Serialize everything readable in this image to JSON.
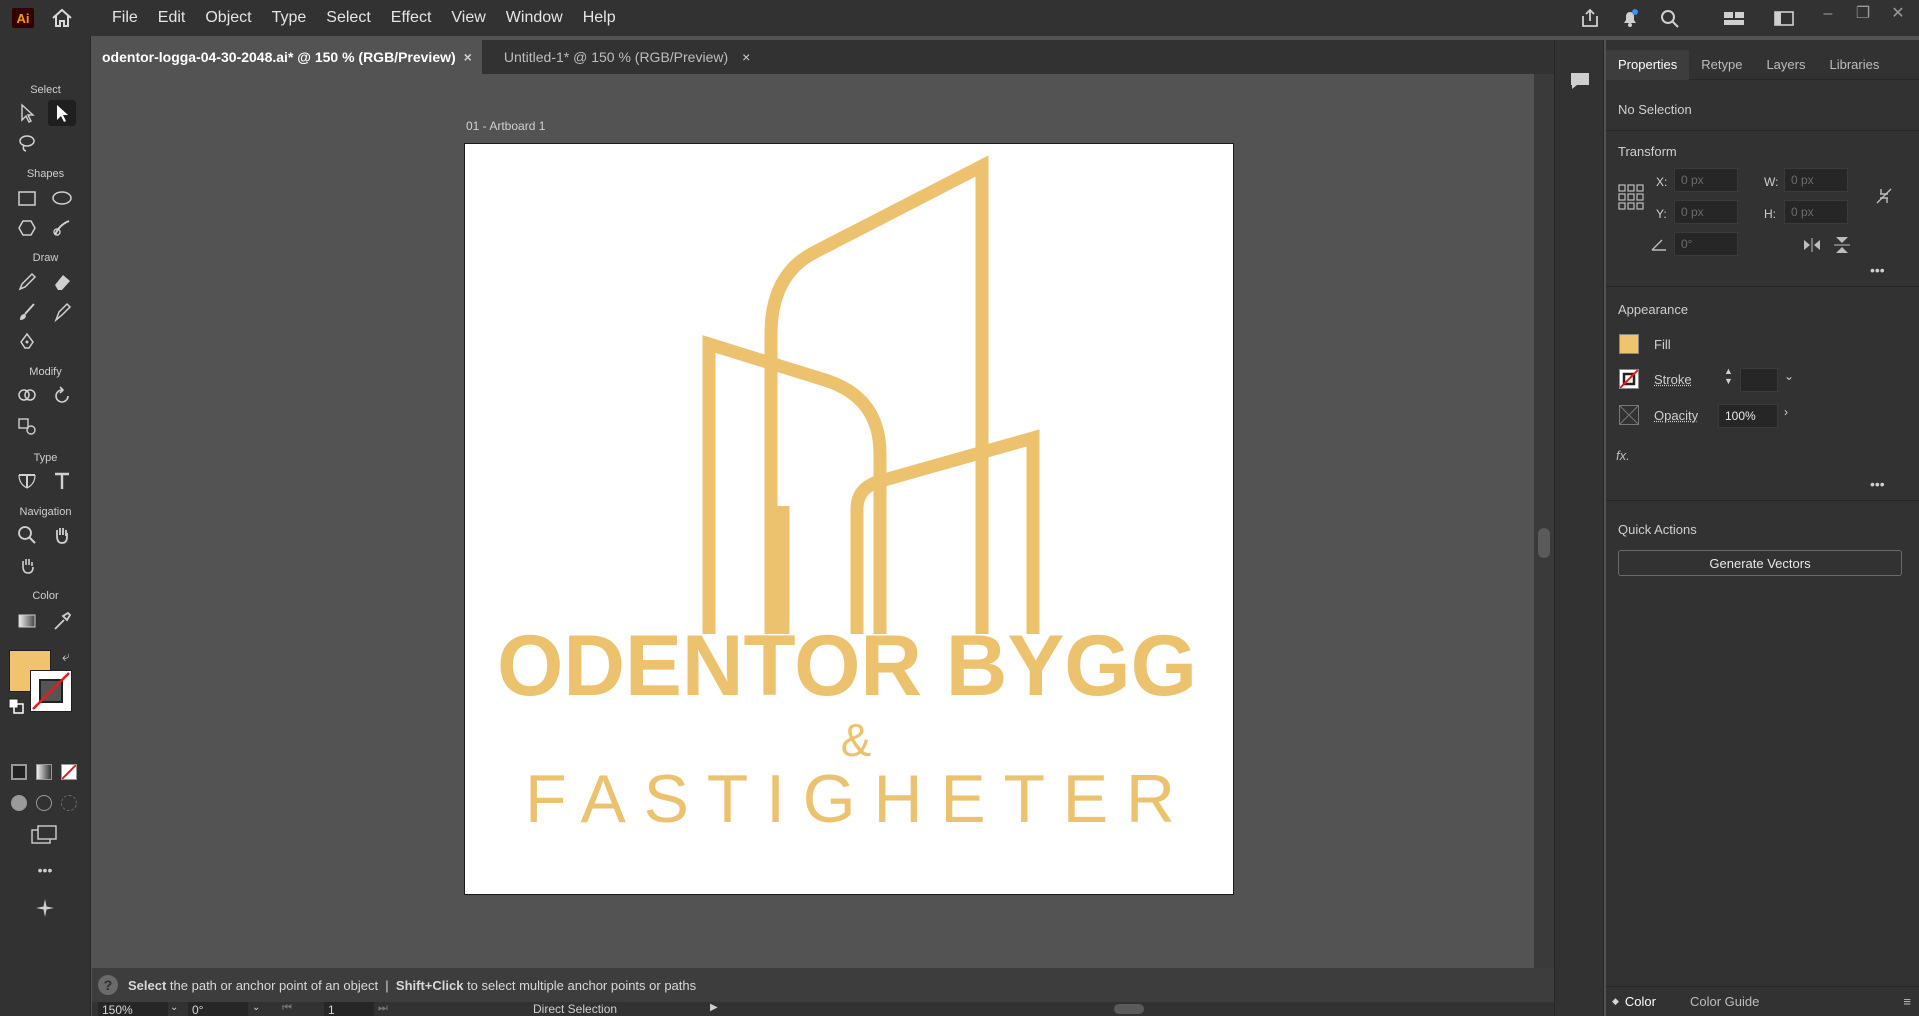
{
  "app": {
    "logo": "Ai"
  },
  "menu": [
    "File",
    "Edit",
    "Object",
    "Type",
    "Select",
    "Effect",
    "View",
    "Window",
    "Help"
  ],
  "toolbar": {
    "sections": [
      "Select",
      "Shapes",
      "Draw",
      "Modify",
      "Type",
      "Navigation",
      "Color"
    ],
    "fill_color": "#f0c46e",
    "more": "•••"
  },
  "tabs": [
    {
      "label": "odentor-logga-04-30-2048.ai* @ 150 % (RGB/Preview)",
      "close": "×"
    },
    {
      "label": "Untitled-1* @ 150 % (RGB/Preview)",
      "close": "×"
    }
  ],
  "artboard": {
    "label": "01 - Artboard 1",
    "logo": {
      "line1": "ODENTOR BYGG",
      "line2": "&",
      "line3": "FASTIGHETER",
      "color": "#ecc26f"
    }
  },
  "status": {
    "help": "?",
    "text_bold1": "Select",
    "text1": " the path or anchor point of an object  |  ",
    "text_bold2": "Shift+Click",
    "text2": " to select multiple anchor points or paths"
  },
  "bottom": {
    "zoom": "150%",
    "rotation": "0°",
    "artboard_num": "1",
    "tool_name": "Direct Selection"
  },
  "panel": {
    "tabs": [
      "Properties",
      "Retype",
      "Layers",
      "Libraries"
    ],
    "selection": "No Selection",
    "transform": {
      "title": "Transform",
      "x_label": "X:",
      "x_value": "0 px",
      "y_label": "Y:",
      "y_value": "0 px",
      "w_label": "W:",
      "w_value": "0 px",
      "h_label": "H:",
      "h_value": "0 px",
      "angle_value": "0°"
    },
    "appearance": {
      "title": "Appearance",
      "fill": "Fill",
      "stroke": "Stroke",
      "opacity": "Opacity",
      "opacity_value": "100%",
      "fx": "fx."
    },
    "quick_actions": {
      "title": "Quick Actions",
      "button": "Generate Vectors"
    },
    "more": "•••",
    "bottom_tabs": [
      "Color",
      "Color Guide"
    ]
  }
}
